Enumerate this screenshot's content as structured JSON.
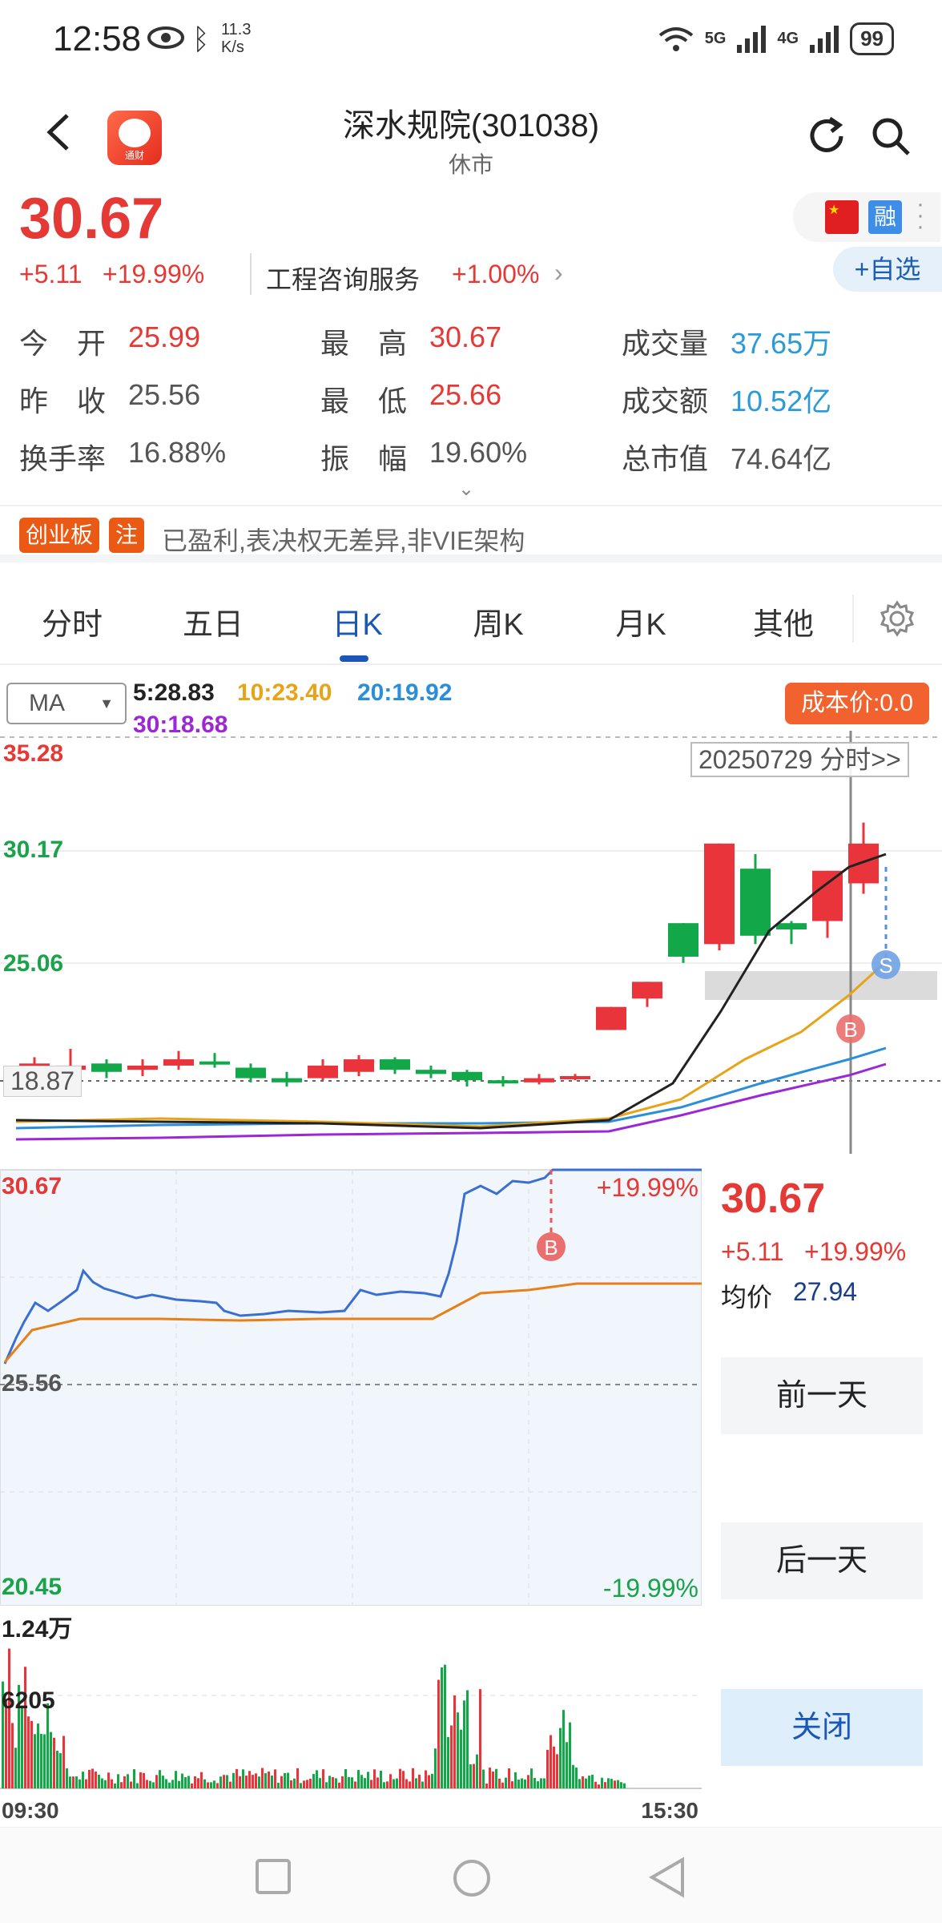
{
  "status_bar": {
    "time": "12:58",
    "net_speed_value": "11.3",
    "net_speed_unit": "K/s",
    "net_5g": "5G",
    "net_4g": "4G",
    "battery": "99"
  },
  "header": {
    "title": "深水规院(301038)",
    "subtitle": "休市",
    "app_logo_text": "通财"
  },
  "quote": {
    "price": "30.67",
    "change": "+5.11",
    "change_pct": "+19.99%",
    "sector_name": "工程咨询服务",
    "sector_pct": "+1.00%",
    "rong_label": "融",
    "add_watch": "+自选"
  },
  "stats": {
    "open_label": "今　开",
    "open": "25.99",
    "prev_close_label": "昨　收",
    "prev_close": "25.56",
    "turnover_rate_label": "换手率",
    "turnover_rate": "16.88%",
    "high_label": "最　高",
    "high": "30.67",
    "low_label": "最　低",
    "low": "25.66",
    "amplitude_label": "振　幅",
    "amplitude": "19.60%",
    "volume_label": "成交量",
    "volume": "37.65万",
    "amount_label": "成交额",
    "amount": "10.52亿",
    "market_cap_label": "总市值",
    "market_cap": "74.64亿"
  },
  "tags": {
    "board": "创业板",
    "note": "注",
    "desc": "已盈利,表决权无差异,非VIE架构"
  },
  "tabs": [
    {
      "label": "分时"
    },
    {
      "label": "五日"
    },
    {
      "label": "日K"
    },
    {
      "label": "周K"
    },
    {
      "label": "月K"
    },
    {
      "label": "其他"
    }
  ],
  "ma": {
    "select": "MA",
    "ma5": "5:28.83",
    "ma10": "10:23.40",
    "ma20": "20:19.92",
    "ma30": "30:18.68",
    "cost_button": "成本价:0.0",
    "colors": {
      "ma5": "#222222",
      "ma10": "#e8a317",
      "ma20": "#2a8fd8",
      "ma30": "#9b27d6"
    }
  },
  "kline": {
    "y_top": "35.28",
    "y_mid": "30.17",
    "y_low": "25.06",
    "ref_price": "18.87",
    "date_button": "20250729 分时>>",
    "marker_b": "B",
    "marker_s": "S",
    "chart_data": {
      "type": "candlestick",
      "note_range": [
        18.87,
        35.28
      ],
      "candles": [
        {
          "o": 19.2,
          "c": 19.7,
          "h": 20.0,
          "l": 18.9
        },
        {
          "o": 19.4,
          "c": 19.6,
          "h": 20.4,
          "l": 19.0
        },
        {
          "o": 19.7,
          "c": 19.3,
          "h": 19.9,
          "l": 19.0
        },
        {
          "o": 19.4,
          "c": 19.6,
          "h": 19.9,
          "l": 19.1
        },
        {
          "o": 19.6,
          "c": 19.9,
          "h": 20.3,
          "l": 19.4
        },
        {
          "o": 19.8,
          "c": 19.7,
          "h": 20.2,
          "l": 19.5
        },
        {
          "o": 19.5,
          "c": 19.0,
          "h": 19.7,
          "l": 18.8
        },
        {
          "o": 19.0,
          "c": 18.8,
          "h": 19.3,
          "l": 18.6
        },
        {
          "o": 19.0,
          "c": 19.6,
          "h": 19.9,
          "l": 18.9
        },
        {
          "o": 19.3,
          "c": 19.9,
          "h": 20.1,
          "l": 19.1
        },
        {
          "o": 19.9,
          "c": 19.4,
          "h": 20.0,
          "l": 19.2
        },
        {
          "o": 19.4,
          "c": 19.2,
          "h": 19.6,
          "l": 19.0
        },
        {
          "o": 19.3,
          "c": 18.9,
          "h": 19.4,
          "l": 18.6
        },
        {
          "o": 18.9,
          "c": 18.8,
          "h": 19.1,
          "l": 18.6
        },
        {
          "o": 18.8,
          "c": 19.0,
          "h": 19.2,
          "l": 18.7
        },
        {
          "o": 19.0,
          "c": 19.1,
          "h": 19.2,
          "l": 18.9
        },
        {
          "o": 21.3,
          "c": 22.4,
          "h": 22.4,
          "l": 21.3
        },
        {
          "o": 22.8,
          "c": 23.6,
          "h": 23.6,
          "l": 22.4
        },
        {
          "o": 26.4,
          "c": 24.8,
          "h": 26.4,
          "l": 24.5
        },
        {
          "o": 25.4,
          "c": 30.2,
          "h": 30.2,
          "l": 25.1
        },
        {
          "o": 29.0,
          "c": 25.8,
          "h": 29.7,
          "l": 25.4
        },
        {
          "o": 26.4,
          "c": 26.1,
          "h": 26.5,
          "l": 25.4
        },
        {
          "o": 26.5,
          "c": 28.9,
          "h": 28.9,
          "l": 25.7
        },
        {
          "o": 28.3,
          "c": 30.2,
          "h": 31.2,
          "l": 27.8
        }
      ]
    }
  },
  "intraday": {
    "y_top": "30.67",
    "y_mid": "25.56",
    "y_bottom": "20.45",
    "pct_top": "+19.99%",
    "pct_bottom": "-19.99%",
    "marker_b": "B",
    "price": "30.67",
    "change": "+5.11",
    "change_pct": "+19.99%",
    "avg_label": "均价",
    "avg": "27.94",
    "prev_day": "前一天",
    "next_day": "后一天",
    "close": "关闭"
  },
  "volume": {
    "top": "1.24万",
    "mid": "6205",
    "start_time": "09:30",
    "end_time": "15:30"
  }
}
